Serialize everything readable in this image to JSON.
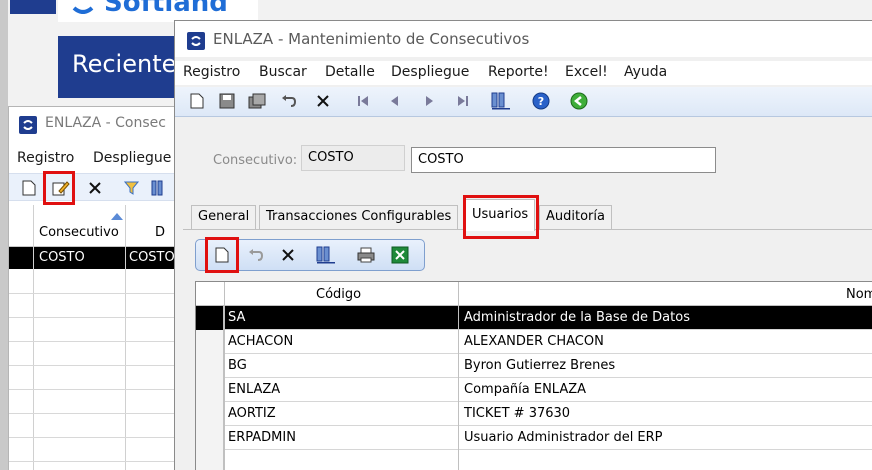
{
  "background_window": {
    "logo_text": "Softland",
    "section_title": "Reciente"
  },
  "list_window": {
    "title": "ENLAZA - Consec",
    "menu": [
      "Registro",
      "Despliegue"
    ],
    "columns": [
      "Consecutivo",
      "D"
    ],
    "selected_row": {
      "consecutivo": "COSTO",
      "descripcion": "COSTO"
    }
  },
  "main_window": {
    "title": "ENLAZA - Mantenimiento de Consecutivos",
    "menu": [
      "Registro",
      "Buscar",
      "Detalle",
      "Despliegue",
      "Reporte!",
      "Excel!",
      "Ayuda"
    ],
    "toolbar_icons": [
      "new-icon",
      "save-icon",
      "save-all-icon",
      "undo-icon",
      "delete-icon",
      "first-icon",
      "prev-icon",
      "next-icon",
      "last-icon",
      "columns-icon",
      "help-icon",
      "exit-icon"
    ],
    "field_label": "Consecutivo:",
    "field_code": "COSTO",
    "field_name": "COSTO",
    "tabs": [
      "General",
      "Transacciones Configurables",
      "Usuarios",
      "Auditoría"
    ],
    "active_tab": "Usuarios",
    "sub_toolbar_icons": [
      "new-icon",
      "undo-icon",
      "delete-icon",
      "columns-icon",
      "print-icon",
      "excel-icon"
    ],
    "grid": {
      "columns": [
        "Código",
        "Nom"
      ],
      "rows": [
        {
          "codigo": "SA",
          "nombre": "Administrador de la Base de Datos"
        },
        {
          "codigo": "ACHACON",
          "nombre": "ALEXANDER CHACON"
        },
        {
          "codigo": "BG",
          "nombre": "Byron Gutierrez Brenes"
        },
        {
          "codigo": "ENLAZA",
          "nombre": "Compañía ENLAZA"
        },
        {
          "codigo": "AORTIZ",
          "nombre": "TICKET # 37630"
        },
        {
          "codigo": "ERPADMIN",
          "nombre": "Usuario Administrador del ERP"
        }
      ],
      "selected_index": 0
    }
  },
  "colors": {
    "accent_blue": "#1f3d8f",
    "highlight_red": "#e01010",
    "selection_black": "#000000"
  }
}
